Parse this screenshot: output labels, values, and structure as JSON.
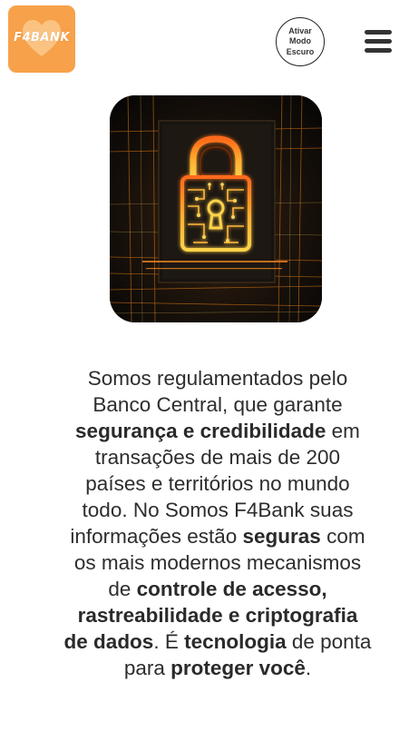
{
  "header": {
    "logo_text": "F4BANK",
    "dark_mode_label": "Ativar\nModo\nEscuro",
    "menu_icon": "hamburger-menu-icon"
  },
  "hero": {
    "image": "padlock-circuit-security-image"
  },
  "content": {
    "t1": "Somos regulamentados pelo Banco Central, que garante ",
    "b1": "segurança e credibilidade",
    "t2": " em transações de mais de 200 países e territórios no mundo todo. No Somos F4Bank suas informações estão ",
    "b2": "seguras",
    "t3": " com os mais modernos mecanismos de ",
    "b3": "controle de acesso, rastreabilidade e criptografia de dados",
    "t4": ". É ",
    "b4": "tecnologia",
    "t5": " de ponta para ",
    "b5": "proteger você",
    "t6": "."
  },
  "colors": {
    "logo_bg": "#f7a14a",
    "text": "#2d2d2d",
    "accent_glow": "#ff9a1f"
  }
}
